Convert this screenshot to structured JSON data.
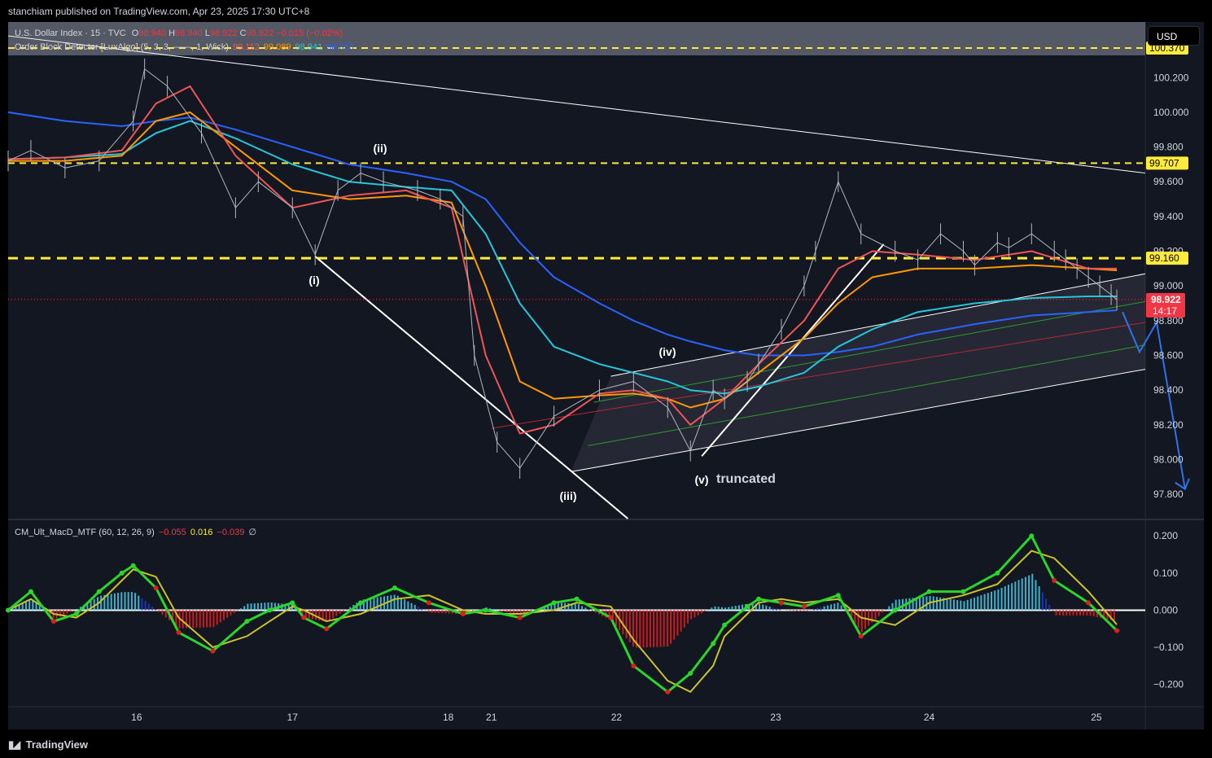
{
  "header": {
    "publisher_line": "stanchiam published on TradingView.com, Apr 23, 2025 17:30 UTC+8"
  },
  "footer": {
    "brand": "TradingView"
  },
  "currency_button": "USD",
  "legend_main": {
    "symbol": "U.S. Dollar Index · 15 · TVC",
    "o_label": "O",
    "o_value": "98.940",
    "h_label": "H",
    "h_value": "98.940",
    "l_label": "L",
    "l_value": "98.922",
    "c_label": "C",
    "c_value": "98.922",
    "change": "−0.015 (−0.02%)"
  },
  "legend_indicator": {
    "name": "Order Block Detector [LuxAlgo] (5, 3, 3, ——, 1, Wick)",
    "values": [
      "99.112",
      "99.089",
      "98.941",
      "98.855"
    ]
  },
  "legend_macd": {
    "name": "CM_Ult_MacD_MTF (60, 12, 26, 9)",
    "values": [
      "−0.055",
      "0.016",
      "−0.039"
    ],
    "suffix": "∅"
  },
  "wave_labels": {
    "i": "(i)",
    "ii": "(ii)",
    "iii": "(iii)",
    "iv": "(iv)",
    "v": "(v)",
    "truncated": "truncated"
  },
  "price_tags": {
    "top": "100.370",
    "upper": "99.707",
    "mid": "99.160",
    "last": "98.922",
    "countdown": "14:17"
  },
  "colors": {
    "background": "#131722",
    "yellow": "#ffeb3b",
    "ema_red": "#f05454",
    "ema_orange": "#ff9800",
    "ema_teal": "#26c6da",
    "ema_blue": "#2962ff",
    "candle": "#b2b5be",
    "arrow": "#2f72ea",
    "last_price": "#f23645",
    "macd_green": "#2bd62b",
    "macd_red": "#e01c1c",
    "hist_blue": "#1d39c9",
    "hist_cyan": "#43c3e0"
  },
  "chart_data": [
    {
      "type": "line",
      "title": "U.S. Dollar Index · 15 · TVC",
      "ylim": [
        97.66,
        100.52
      ],
      "y_ticks": [
        "100.200",
        "100.000",
        "99.800",
        "99.600",
        "99.400",
        "99.200",
        "99.000",
        "98.800",
        "98.600",
        "98.400",
        "98.200",
        "98.000",
        "97.800"
      ],
      "x_ticks": [
        "16",
        "17",
        "18",
        "21",
        "22",
        "23",
        "24",
        "25"
      ],
      "grid": false,
      "horizontal_levels": [
        100.37,
        99.707,
        99.16
      ],
      "last_price": 98.922,
      "series": [
        {
          "name": "",
          "kind": "price",
          "x": [
            0,
            0.02,
            0.05,
            0.08,
            0.11,
            0.12,
            0.14,
            0.17,
            0.2,
            0.22,
            0.25,
            0.27,
            0.29,
            0.31,
            0.33,
            0.36,
            0.38,
            0.4,
            0.41,
            0.43,
            0.45,
            0.48,
            0.52,
            0.55,
            0.58,
            0.6,
            0.62,
            0.63,
            0.65,
            0.66,
            0.68,
            0.7,
            0.71,
            0.73,
            0.75,
            0.78,
            0.8,
            0.82,
            0.84,
            0.85,
            0.87,
            0.88,
            0.9,
            0.92,
            0.93,
            0.94,
            0.95,
            0.96,
            0.97,
            0.975
          ],
          "values": [
            99.72,
            99.78,
            99.68,
            99.72,
            99.95,
            100.25,
            100.15,
            99.88,
            99.45,
            99.6,
            99.45,
            99.18,
            99.55,
            99.65,
            99.6,
            99.55,
            99.5,
            99.4,
            98.6,
            98.1,
            97.95,
            98.25,
            98.4,
            98.45,
            98.3,
            98.05,
            98.4,
            98.35,
            98.45,
            98.55,
            98.75,
            99.0,
            99.2,
            99.6,
            99.3,
            99.2,
            99.15,
            99.3,
            99.2,
            99.12,
            99.25,
            99.22,
            99.3,
            99.2,
            99.15,
            99.1,
            99.05,
            99.0,
            98.95,
            98.92
          ]
        },
        {
          "name": "",
          "kind": "ema-fast",
          "x": [
            0,
            0.05,
            0.1,
            0.13,
            0.16,
            0.2,
            0.25,
            0.3,
            0.35,
            0.39,
            0.42,
            0.45,
            0.48,
            0.52,
            0.55,
            0.58,
            0.6,
            0.63,
            0.66,
            0.7,
            0.73,
            0.76,
            0.8,
            0.85,
            0.9,
            0.95,
            0.975
          ],
          "values": [
            99.73,
            99.74,
            99.78,
            100.05,
            100.15,
            99.75,
            99.45,
            99.52,
            99.55,
            99.45,
            98.6,
            98.15,
            98.2,
            98.38,
            98.4,
            98.35,
            98.2,
            98.35,
            98.55,
            98.8,
            99.1,
            99.2,
            99.18,
            99.15,
            99.2,
            99.1,
            99.1
          ]
        },
        {
          "name": "",
          "kind": "ema-mid",
          "x": [
            0,
            0.05,
            0.1,
            0.13,
            0.16,
            0.2,
            0.25,
            0.3,
            0.35,
            0.39,
            0.42,
            0.45,
            0.48,
            0.52,
            0.55,
            0.58,
            0.6,
            0.63,
            0.66,
            0.7,
            0.73,
            0.76,
            0.8,
            0.85,
            0.9,
            0.95,
            0.975
          ],
          "values": [
            99.72,
            99.72,
            99.75,
            99.95,
            100.0,
            99.8,
            99.55,
            99.5,
            99.52,
            99.48,
            99.0,
            98.45,
            98.35,
            98.37,
            98.38,
            98.35,
            98.3,
            98.35,
            98.5,
            98.7,
            98.9,
            99.05,
            99.1,
            99.1,
            99.12,
            99.1,
            99.09
          ]
        },
        {
          "name": "",
          "kind": "ema-slow",
          "x": [
            0,
            0.05,
            0.1,
            0.13,
            0.16,
            0.2,
            0.25,
            0.3,
            0.35,
            0.39,
            0.42,
            0.45,
            0.48,
            0.52,
            0.55,
            0.58,
            0.6,
            0.63,
            0.66,
            0.7,
            0.73,
            0.76,
            0.8,
            0.85,
            0.9,
            0.95,
            0.975
          ],
          "values": [
            99.73,
            99.74,
            99.76,
            99.88,
            99.95,
            99.85,
            99.7,
            99.6,
            99.57,
            99.55,
            99.3,
            98.9,
            98.65,
            98.55,
            98.5,
            98.45,
            98.4,
            98.38,
            98.42,
            98.5,
            98.65,
            98.75,
            98.85,
            98.9,
            98.93,
            98.94,
            98.94
          ]
        },
        {
          "name": "",
          "kind": "ema-long",
          "x": [
            0,
            0.05,
            0.1,
            0.13,
            0.16,
            0.2,
            0.25,
            0.3,
            0.35,
            0.39,
            0.42,
            0.45,
            0.48,
            0.52,
            0.55,
            0.58,
            0.6,
            0.63,
            0.66,
            0.7,
            0.73,
            0.76,
            0.8,
            0.85,
            0.9,
            0.95,
            0.975
          ],
          "values": [
            100.0,
            99.95,
            99.92,
            99.95,
            99.97,
            99.9,
            99.8,
            99.7,
            99.65,
            99.6,
            99.5,
            99.25,
            99.05,
            98.9,
            98.8,
            98.72,
            98.68,
            98.63,
            98.6,
            98.6,
            98.62,
            98.65,
            98.72,
            98.78,
            98.83,
            98.85,
            98.86
          ]
        }
      ],
      "forecast_path": {
        "x": [
          0.98,
          0.995,
          1.01,
          1.035
        ],
        "values": [
          98.85,
          98.62,
          98.79,
          97.83
        ]
      }
    },
    {
      "type": "bar",
      "title": "CM_Ult_MacD_MTF (60, 12, 26, 9)",
      "ylim": [
        -0.26,
        0.24
      ],
      "y_ticks": [
        "0.200",
        "0.100",
        "0.000",
        "−0.100",
        "−0.200"
      ],
      "series": [
        {
          "name": "",
          "kind": "macd",
          "x": [
            0,
            0.02,
            0.04,
            0.06,
            0.08,
            0.1,
            0.11,
            0.13,
            0.15,
            0.18,
            0.21,
            0.23,
            0.25,
            0.26,
            0.28,
            0.31,
            0.34,
            0.37,
            0.4,
            0.42,
            0.45,
            0.48,
            0.5,
            0.53,
            0.55,
            0.58,
            0.6,
            0.62,
            0.63,
            0.65,
            0.66,
            0.68,
            0.7,
            0.73,
            0.75,
            0.78,
            0.81,
            0.84,
            0.87,
            0.9,
            0.92,
            0.95,
            0.975
          ],
          "values": [
            0.0,
            0.05,
            -0.03,
            -0.01,
            0.05,
            0.1,
            0.12,
            0.06,
            -0.06,
            -0.11,
            -0.03,
            0.0,
            0.02,
            -0.02,
            -0.05,
            0.02,
            0.06,
            0.02,
            -0.01,
            0.0,
            -0.02,
            0.02,
            0.03,
            -0.02,
            -0.15,
            -0.22,
            -0.17,
            -0.09,
            -0.04,
            0.01,
            0.03,
            0.02,
            0.01,
            0.04,
            -0.07,
            0.0,
            0.05,
            0.05,
            0.1,
            0.2,
            0.08,
            0.02,
            -0.055
          ]
        },
        {
          "name": "",
          "kind": "signal",
          "x": [
            0,
            0.02,
            0.04,
            0.06,
            0.08,
            0.1,
            0.11,
            0.13,
            0.15,
            0.18,
            0.21,
            0.23,
            0.25,
            0.26,
            0.28,
            0.31,
            0.34,
            0.37,
            0.4,
            0.42,
            0.45,
            0.48,
            0.5,
            0.53,
            0.55,
            0.58,
            0.6,
            0.62,
            0.63,
            0.65,
            0.66,
            0.68,
            0.7,
            0.73,
            0.75,
            0.78,
            0.81,
            0.84,
            0.87,
            0.9,
            0.92,
            0.95,
            0.975
          ],
          "values": [
            0.0,
            0.03,
            -0.01,
            -0.02,
            0.02,
            0.08,
            0.11,
            0.09,
            -0.02,
            -0.1,
            -0.07,
            -0.03,
            0.01,
            0.0,
            -0.03,
            -0.01,
            0.03,
            0.04,
            0.0,
            -0.01,
            -0.01,
            0.0,
            0.02,
            0.01,
            -0.08,
            -0.19,
            -0.22,
            -0.15,
            -0.07,
            -0.01,
            0.02,
            0.03,
            0.02,
            0.03,
            -0.02,
            -0.04,
            0.02,
            0.04,
            0.07,
            0.16,
            0.14,
            0.05,
            -0.039
          ]
        }
      ]
    }
  ]
}
